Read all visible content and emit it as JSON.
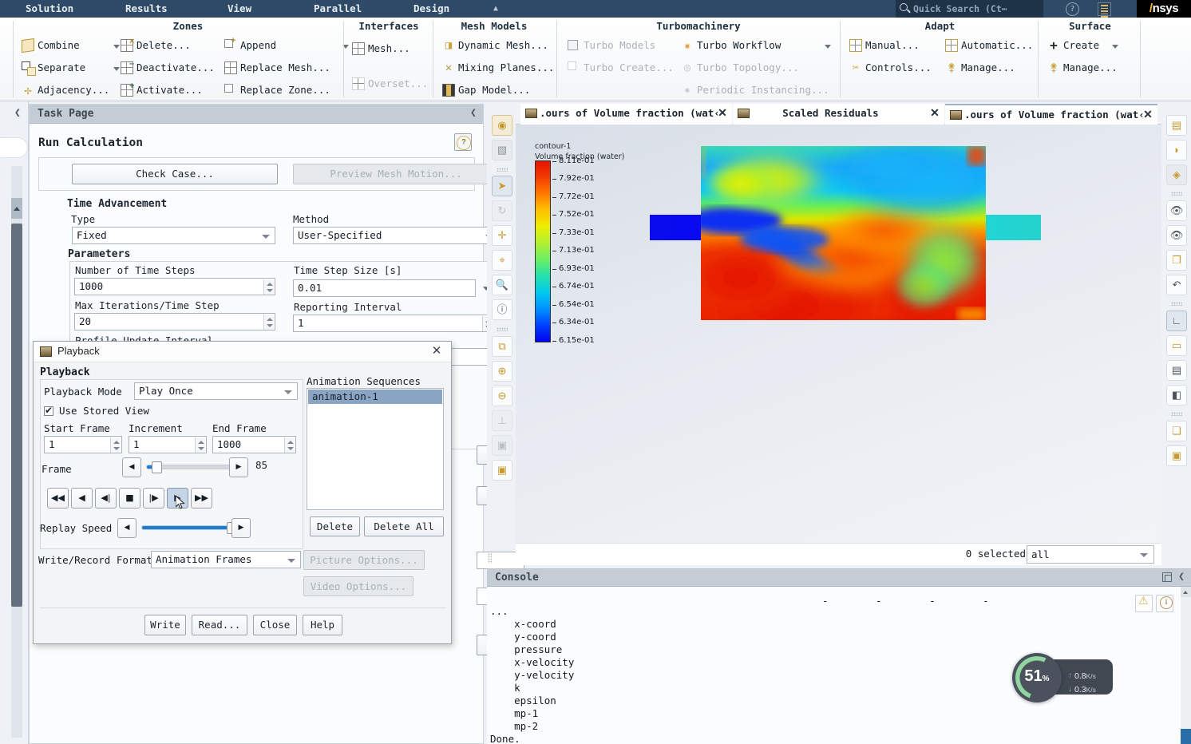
{
  "menu": {
    "items": [
      "Solution",
      "Results",
      "View",
      "Parallel",
      "Design"
    ],
    "collapse_arrow": "▲",
    "quick_search_placeholder": "Quick Search (Ct⋯",
    "search_icon": "search-icon",
    "help_icon": "help-circle-icon",
    "book_icon": "book-icon",
    "logo_a": "/",
    "logo_text": "nsys"
  },
  "ribbon": {
    "groups": [
      {
        "title": "Zones",
        "items": [
          {
            "label": "Combine",
            "icon": "cube-icon",
            "disabled": false,
            "dropdown": true
          },
          {
            "label": "Separate",
            "icon": "separate-icon",
            "disabled": false,
            "dropdown": true
          },
          {
            "label": "Adjacency...",
            "icon": "adjacency-icon",
            "disabled": false,
            "dropdown": false
          },
          {
            "label": "Delete...",
            "icon": "grid-delete-icon",
            "disabled": false,
            "dropdown": false
          },
          {
            "label": "Deactivate...",
            "icon": "grid-deactivate-icon",
            "disabled": false,
            "dropdown": false
          },
          {
            "label": "Activate...",
            "icon": "grid-activate-icon",
            "disabled": false,
            "dropdown": false
          },
          {
            "label": "Append",
            "icon": "append-icon",
            "disabled": false,
            "dropdown": true
          },
          {
            "label": "Replace Mesh...",
            "icon": "replace-mesh-icon",
            "disabled": false,
            "dropdown": false
          },
          {
            "label": "Replace Zone...",
            "icon": "replace-zone-icon",
            "disabled": false,
            "dropdown": false
          }
        ]
      },
      {
        "title": "Interfaces",
        "items": [
          {
            "label": "Mesh...",
            "icon": "mesh-interface-icon",
            "disabled": false,
            "dropdown": false
          },
          {
            "label": "Overset...",
            "icon": "overset-icon",
            "disabled": true,
            "dropdown": false
          }
        ]
      },
      {
        "title": "Mesh Models",
        "items": [
          {
            "label": "Dynamic Mesh...",
            "icon": "dynamic-mesh-icon",
            "disabled": false,
            "dropdown": false
          },
          {
            "label": "Mixing Planes...",
            "icon": "mixing-planes-icon",
            "disabled": false,
            "dropdown": false
          },
          {
            "label": "Gap Model...",
            "icon": "gap-model-icon",
            "disabled": false,
            "dropdown": false
          }
        ]
      },
      {
        "title": "Turbomachinery",
        "items": [
          {
            "label": "Turbo Models",
            "icon": "checkbox-icon",
            "disabled": true,
            "dropdown": false
          },
          {
            "label": "Turbo Create...",
            "icon": "turbo-create-icon",
            "disabled": true,
            "dropdown": false
          },
          {
            "label": "Turbo Workflow",
            "icon": "turbo-workflow-icon",
            "disabled": false,
            "dropdown": true
          },
          {
            "label": "Turbo Topology...",
            "icon": "turbo-topology-icon",
            "disabled": true,
            "dropdown": false
          },
          {
            "label": "Periodic Instancing...",
            "icon": "periodic-instancing-icon",
            "disabled": true,
            "dropdown": false
          }
        ]
      },
      {
        "title": "Adapt",
        "items": [
          {
            "label": "Manual...",
            "icon": "adapt-manual-icon",
            "disabled": false,
            "dropdown": false
          },
          {
            "label": "Controls...",
            "icon": "adapt-controls-icon",
            "disabled": false,
            "dropdown": false
          },
          {
            "label": "Automatic...",
            "icon": "adapt-automatic-icon",
            "disabled": false,
            "dropdown": false
          },
          {
            "label": "Manage...",
            "icon": "adapt-manage-icon",
            "disabled": false,
            "dropdown": false
          }
        ]
      },
      {
        "title": "Surface",
        "items": [
          {
            "label": "Create",
            "icon": "plus-icon",
            "disabled": false,
            "dropdown": true
          },
          {
            "label": "Manage...",
            "icon": "surface-manage-icon",
            "disabled": false,
            "dropdown": false
          }
        ]
      }
    ]
  },
  "task_page": {
    "header": "Task Page",
    "collapse_icon": "chevron-left-icon",
    "title": "Run Calculation",
    "help_icon": "help-icon",
    "check_case_label": "Check Case...",
    "preview_mesh_motion_label": "Preview Mesh Motion...",
    "time_advancement_label": "Time Advancement",
    "type_label": "Type",
    "type_value": "Fixed",
    "method_label": "Method",
    "method_value": "User-Specified",
    "parameters_label": "Parameters",
    "number_of_time_steps_label": "Number of Time Steps",
    "number_of_time_steps_value": "1000",
    "time_step_size_label": "Time Step Size [s]",
    "time_step_size_value": "0.01",
    "max_iterations_label": "Max Iterations/Time Step",
    "max_iterations_value": "20",
    "reporting_interval_label": "Reporting Interval",
    "reporting_interval_value": "1",
    "profile_update_interval_label": "Profile Update Interval"
  },
  "playback_dialog": {
    "window_title": "Playback",
    "window_icon": "playback-icon",
    "close_icon": "close-icon",
    "section_label": "Playback",
    "playback_mode_label": "Playback Mode",
    "playback_mode_value": "Play Once",
    "use_stored_view_label": "Use Stored View",
    "use_stored_view_checked": true,
    "start_frame_label": "Start Frame",
    "start_frame_value": "1",
    "increment_label": "Increment",
    "increment_value": "1",
    "end_frame_label": "End Frame",
    "end_frame_value": "1000",
    "frame_label": "Frame",
    "frame_value": "85",
    "frame_slider_percent": 6,
    "replay_speed_label": "Replay Speed",
    "replay_speed_percent": 92,
    "transport_buttons": [
      {
        "name": "rewind-to-start-button",
        "glyph": "◀◀"
      },
      {
        "name": "play-reverse-button",
        "glyph": "◀"
      },
      {
        "name": "step-back-button",
        "glyph": "◀|"
      },
      {
        "name": "stop-button",
        "glyph": "■"
      },
      {
        "name": "step-forward-button",
        "glyph": "|▶"
      },
      {
        "name": "play-button",
        "glyph": "▶"
      },
      {
        "name": "fast-forward-button",
        "glyph": "▶▶"
      }
    ],
    "animation_sequences_label": "Animation Sequences",
    "animation_sequences": [
      "animation-1"
    ],
    "delete_label": "Delete",
    "delete_all_label": "Delete All",
    "write_record_format_label": "Write/Record Format",
    "write_record_format_value": "Animation Frames",
    "picture_options_label": "Picture Options...",
    "video_options_label": "Video Options...",
    "write_label": "Write",
    "read_label": "Read...",
    "close_label": "Close",
    "help_label": "Help"
  },
  "graphics": {
    "left_toolbar": [
      {
        "name": "compass-orientation-icon",
        "glyph": "◉",
        "state": "normal"
      },
      {
        "name": "mesh-display-icon",
        "glyph": "▧",
        "state": "normal"
      },
      {
        "name": "select-pointer-icon",
        "glyph": "➤",
        "state": "selected"
      },
      {
        "name": "rotate-icon",
        "glyph": "↻",
        "state": "disabled"
      },
      {
        "name": "pan-icon",
        "glyph": "✛",
        "state": "normal"
      },
      {
        "name": "zoom-box-icon",
        "glyph": "⌖",
        "state": "normal"
      },
      {
        "name": "magnifier-icon",
        "glyph": "○",
        "state": "normal"
      },
      {
        "name": "probe-info-icon",
        "glyph": "i",
        "state": "normal"
      },
      {
        "name": "zoom-to-fit-icon",
        "glyph": "⧉",
        "state": "normal"
      },
      {
        "name": "zoom-in-icon",
        "glyph": "⊖",
        "state": "normal"
      },
      {
        "name": "zoom-out-icon",
        "glyph": "⊖",
        "state": "normal"
      },
      {
        "name": "axis-triad-icon",
        "glyph": "⟂",
        "state": "disabled"
      },
      {
        "name": "camera-box-icon",
        "glyph": "▣",
        "state": "disabled"
      },
      {
        "name": "lock-view-icon",
        "glyph": "🔒",
        "state": "normal"
      }
    ],
    "right_toolbar": [
      {
        "name": "contour-style-icon",
        "glyph": "▬",
        "state": "normal"
      },
      {
        "name": "shading-icon",
        "glyph": "◗",
        "state": "normal"
      },
      {
        "name": "transparency-icon",
        "glyph": "◈",
        "state": "normal"
      },
      {
        "name": "show-visible-icon",
        "glyph": "👁",
        "state": "normal"
      },
      {
        "name": "hide-icon",
        "glyph": "👁",
        "state": "normal"
      },
      {
        "name": "copy-view-icon",
        "glyph": "❐",
        "state": "normal"
      },
      {
        "name": "undo-view-icon",
        "glyph": "↶",
        "state": "normal"
      },
      {
        "name": "axes-icon",
        "glyph": "∟",
        "state": "selected"
      },
      {
        "name": "colormap-icon",
        "glyph": "▭",
        "state": "normal"
      },
      {
        "name": "text-annotation-icon",
        "glyph": "▤",
        "state": "normal"
      },
      {
        "name": "lighting-icon",
        "glyph": "◧",
        "state": "normal"
      },
      {
        "name": "copy-screen-icon",
        "glyph": "❏",
        "state": "normal"
      },
      {
        "name": "save-picture-icon",
        "glyph": "▣",
        "state": "normal"
      }
    ],
    "tabs": [
      {
        "label": ".ours of Volume fraction (wat‹",
        "active": false,
        "icon": "contour-tab-icon"
      },
      {
        "label": "Scaled Residuals",
        "active": false,
        "icon": "residuals-tab-icon"
      },
      {
        "label": ".ours of Volume fraction (wat‹",
        "active": true,
        "icon": "contour-tab-icon"
      }
    ],
    "selection_count_label": "0 selected",
    "selection_filter_value": "all"
  },
  "chart_data": {
    "type": "heatmap",
    "title": "contour-1",
    "subtitle": "Volume fraction (water)",
    "colorbar_labels": [
      "8.11e-01",
      "7.92e-01",
      "7.72e-01",
      "7.52e-01",
      "7.33e-01",
      "7.13e-01",
      "6.93e-01",
      "6.74e-01",
      "6.54e-01",
      "6.34e-01",
      "6.15e-01"
    ],
    "vmin": 0.615,
    "vmax": 0.811,
    "colormap": "rainbow",
    "field": "Volume fraction (water)"
  },
  "console": {
    "title": "Console",
    "popout_icon": "popout-icon",
    "collapse_icon": "chevron-left-icon",
    "warning_icon": "warning-icon",
    "info_icon": "info-icon",
    "dash_row": "-   -   -   -",
    "lines": [
      "...",
      "    x-coord",
      "    y-coord",
      "    pressure",
      "    x-velocity",
      "    y-velocity",
      "    k",
      "    epsilon",
      "    mp-1",
      "    mp-2",
      "Done."
    ]
  },
  "net_widget": {
    "percent": "51",
    "percent_unit": "%",
    "upload": "0.8",
    "upload_unit": "K/s",
    "download": "0.3",
    "download_unit": "K/s",
    "up_arrow": "↑",
    "down_arrow": "↓"
  }
}
